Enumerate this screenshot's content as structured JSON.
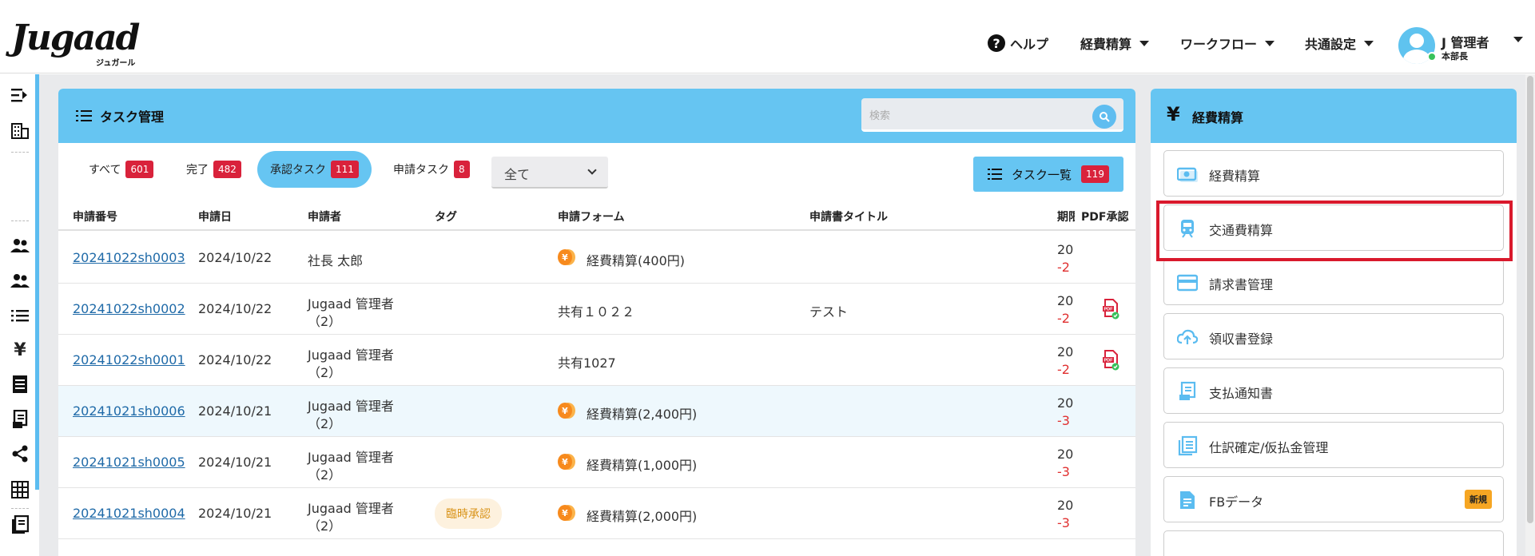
{
  "header": {
    "logo": "Jugaad",
    "logo_sub": "ジュガール",
    "nav": [
      {
        "label": "ヘルプ"
      },
      {
        "label": "経費精算"
      },
      {
        "label": "ワークフロー"
      },
      {
        "label": "共通設定"
      }
    ],
    "user_name": "J 管理者",
    "user_role": "本部長"
  },
  "task_panel": {
    "title": "タスク管理",
    "search_placeholder": "検索",
    "filters": [
      {
        "label": "すべて",
        "count": "601"
      },
      {
        "label": "完了",
        "count": "482"
      },
      {
        "label": "承認タスク",
        "count": "111"
      },
      {
        "label": "申請タスク",
        "count": "8"
      }
    ],
    "select_value": "全て",
    "task_list_label": "タスク一覧",
    "task_list_count": "119",
    "columns": [
      "申請番号",
      "申請日",
      "申請者",
      "タグ",
      "申請フォーム",
      "申請書タイトル",
      "期限",
      "PDF承認"
    ],
    "rows": [
      {
        "id": "20241022sh0003",
        "date": "2024/10/22",
        "applicant1": "社長 太郎",
        "applicant2": "",
        "tag": "",
        "form": "経費精算(400円)",
        "coin": true,
        "title": "",
        "due": "20",
        "due2": "-2",
        "pdf": false
      },
      {
        "id": "20241022sh0002",
        "date": "2024/10/22",
        "applicant1": "Jugaad 管理者",
        "applicant2": "（2）",
        "tag": "",
        "form": "共有１０２２",
        "coin": false,
        "title": "テスト",
        "due": "20",
        "due2": "-2",
        "pdf": true
      },
      {
        "id": "20241022sh0001",
        "date": "2024/10/22",
        "applicant1": "Jugaad 管理者",
        "applicant2": "（2）",
        "tag": "",
        "form": "共有1027",
        "coin": false,
        "title": "",
        "due": "20",
        "due2": "-2",
        "pdf": true
      },
      {
        "id": "20241021sh0006",
        "date": "2024/10/21",
        "applicant1": "Jugaad 管理者",
        "applicant2": "（2）",
        "tag": "",
        "form": "経費精算(2,400円)",
        "coin": true,
        "title": "",
        "due": "20",
        "due2": "-3",
        "pdf": false
      },
      {
        "id": "20241021sh0005",
        "date": "2024/10/21",
        "applicant1": "Jugaad 管理者",
        "applicant2": "（2）",
        "tag": "",
        "form": "経費精算(1,000円)",
        "coin": true,
        "title": "",
        "due": "20",
        "due2": "-3",
        "pdf": false
      },
      {
        "id": "20241021sh0004",
        "date": "2024/10/21",
        "applicant1": "Jugaad 管理者",
        "applicant2": "（2）",
        "tag": "臨時承認",
        "form": "経費精算(2,000円)",
        "coin": true,
        "title": "",
        "due": "20",
        "due2": "-3",
        "pdf": false
      }
    ]
  },
  "side_panel": {
    "title": "経費精算",
    "items": [
      {
        "label": "経費精算",
        "icon": "money-icon"
      },
      {
        "label": "交通費精算",
        "icon": "train-icon"
      },
      {
        "label": "請求書管理",
        "icon": "card-icon"
      },
      {
        "label": "領収書登録",
        "icon": "cloud-upload-icon"
      },
      {
        "label": "支払通知書",
        "icon": "receipt-icon"
      },
      {
        "label": "仕訳確定/仮払金管理",
        "icon": "documents-icon"
      },
      {
        "label": "FBデータ",
        "icon": "file-icon",
        "badge": "新規"
      }
    ]
  },
  "colors": {
    "accent": "#66c5f2",
    "badge": "#d9223b",
    "highlight": "#d9192c"
  }
}
